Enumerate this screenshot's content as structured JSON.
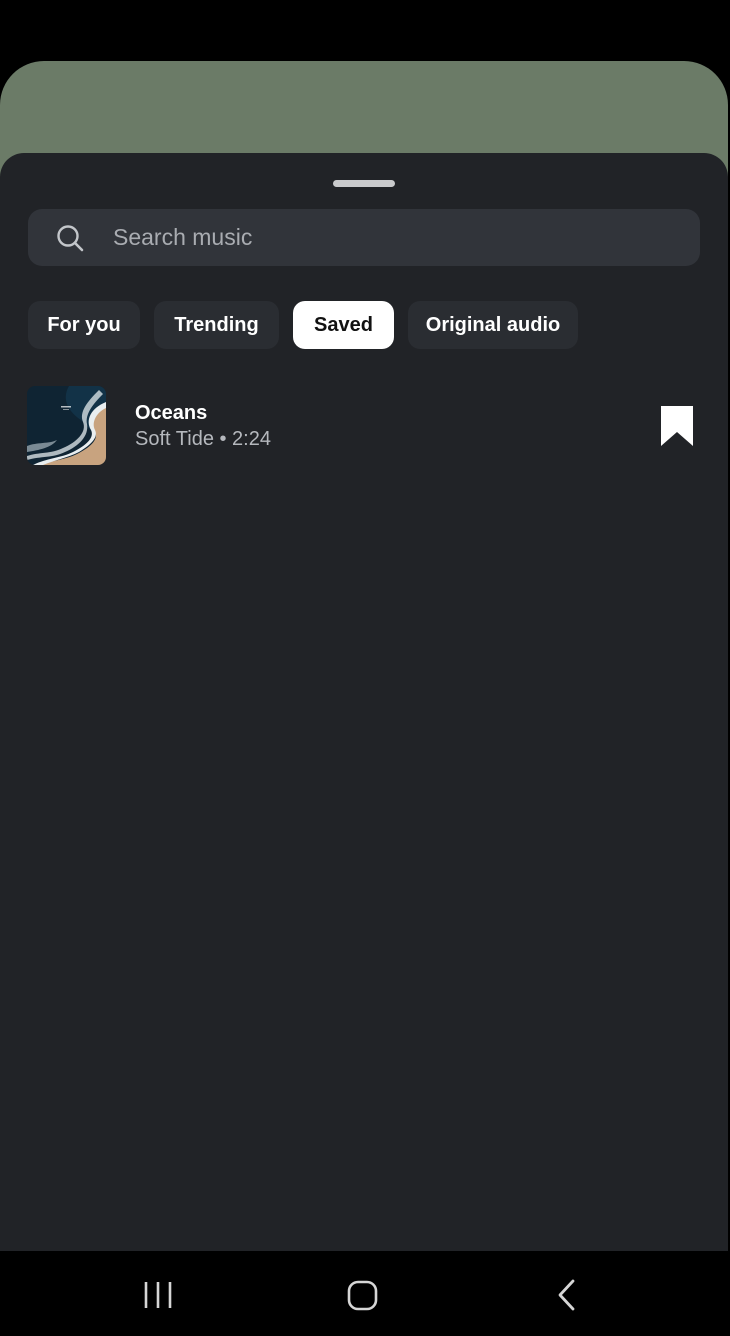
{
  "search": {
    "placeholder": "Search music",
    "icon": "search-icon"
  },
  "tabs": [
    {
      "label": "For you",
      "active": false
    },
    {
      "label": "Trending",
      "active": false
    },
    {
      "label": "Saved",
      "active": true
    },
    {
      "label": "Original audio",
      "active": false
    }
  ],
  "tracks": [
    {
      "title": "Oceans",
      "meta": "Soft Tide • 2:24",
      "saved": true,
      "icon": "bookmark-icon"
    }
  ],
  "navbar": {
    "icons": [
      "recent-apps-icon",
      "home-icon",
      "back-icon"
    ]
  },
  "colors": {
    "sheet": "#212327",
    "search_bg": "#31343a",
    "chip_bg": "#2a2d32",
    "chip_active_bg": "#ffffff",
    "backdrop": "#6b7b67"
  }
}
